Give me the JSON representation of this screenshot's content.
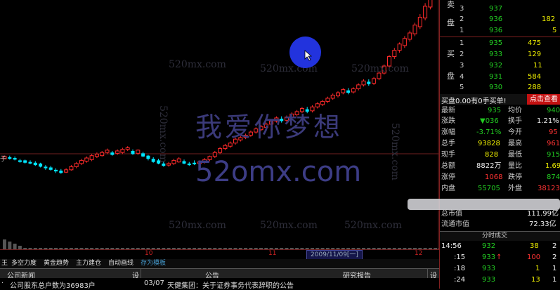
{
  "chart": {
    "watermark_url_small": "520mx.com",
    "watermark_cn": "我爱你梦想",
    "watermark_url_big": "52omx.com",
    "y_axis_cut_label": "子",
    "x_ticks": [
      "10",
      "11",
      "12"
    ],
    "date_label": "2009/11/09[一]",
    "colors": {
      "up": "#ff2b2b",
      "down": "#00e5ff",
      "background": "#000000",
      "axis": "#702020"
    },
    "candles": [
      {
        "o": 192,
        "c": 195,
        "h": 193,
        "l": 196
      },
      {
        "o": 194,
        "c": 192,
        "h": 191,
        "l": 196
      },
      {
        "o": 193,
        "c": 191,
        "h": 190,
        "l": 195
      },
      {
        "o": 190,
        "c": 188,
        "h": 187,
        "l": 192
      },
      {
        "o": 190,
        "c": 187,
        "h": 186,
        "l": 191
      },
      {
        "o": 188,
        "c": 186,
        "h": 185,
        "l": 190
      },
      {
        "o": 187,
        "c": 184,
        "h": 183,
        "l": 189
      },
      {
        "o": 186,
        "c": 182,
        "h": 181,
        "l": 187
      },
      {
        "o": 182,
        "c": 180,
        "h": 178,
        "l": 184
      },
      {
        "o": 181,
        "c": 178,
        "h": 177,
        "l": 183
      },
      {
        "o": 178,
        "c": 176,
        "h": 174,
        "l": 180
      },
      {
        "o": 177,
        "c": 174,
        "h": 173,
        "l": 179
      },
      {
        "o": 175,
        "c": 178,
        "h": 174,
        "l": 180
      },
      {
        "o": 178,
        "c": 182,
        "h": 177,
        "l": 184
      },
      {
        "o": 182,
        "c": 186,
        "h": 180,
        "l": 188
      },
      {
        "o": 186,
        "c": 190,
        "h": 184,
        "l": 192
      },
      {
        "o": 189,
        "c": 193,
        "h": 187,
        "l": 195
      },
      {
        "o": 191,
        "c": 196,
        "h": 189,
        "l": 198
      },
      {
        "o": 195,
        "c": 198,
        "h": 193,
        "l": 200
      },
      {
        "o": 196,
        "c": 200,
        "h": 195,
        "l": 202
      },
      {
        "o": 200,
        "c": 203,
        "h": 198,
        "l": 205
      },
      {
        "o": 200,
        "c": 197,
        "h": 196,
        "l": 202
      },
      {
        "o": 199,
        "c": 202,
        "h": 197,
        "l": 204
      },
      {
        "o": 200,
        "c": 204,
        "h": 198,
        "l": 206
      },
      {
        "o": 204,
        "c": 206,
        "h": 202,
        "l": 208
      },
      {
        "o": 202,
        "c": 198,
        "h": 197,
        "l": 204
      },
      {
        "o": 199,
        "c": 203,
        "h": 197,
        "l": 204
      },
      {
        "o": 199,
        "c": 195,
        "h": 194,
        "l": 201
      },
      {
        "o": 196,
        "c": 192,
        "h": 190,
        "l": 197
      },
      {
        "o": 192,
        "c": 188,
        "h": 187,
        "l": 194
      },
      {
        "o": 190,
        "c": 186,
        "h": 185,
        "l": 192
      },
      {
        "o": 186,
        "c": 183,
        "h": 182,
        "l": 188
      },
      {
        "o": 184,
        "c": 186,
        "h": 182,
        "l": 188
      },
      {
        "o": 186,
        "c": 190,
        "h": 184,
        "l": 192
      },
      {
        "o": 188,
        "c": 192,
        "h": 187,
        "l": 194
      },
      {
        "o": 189,
        "c": 186,
        "h": 185,
        "l": 191
      },
      {
        "o": 186,
        "c": 184,
        "h": 183,
        "l": 188
      },
      {
        "o": 187,
        "c": 185,
        "h": 184,
        "l": 190
      },
      {
        "o": 186,
        "c": 188,
        "h": 184,
        "l": 190
      },
      {
        "o": 188,
        "c": 191,
        "h": 186,
        "l": 193
      },
      {
        "o": 191,
        "c": 195,
        "h": 189,
        "l": 196
      },
      {
        "o": 195,
        "c": 200,
        "h": 193,
        "l": 202
      },
      {
        "o": 200,
        "c": 205,
        "h": 198,
        "l": 207
      },
      {
        "o": 205,
        "c": 209,
        "h": 203,
        "l": 211
      },
      {
        "o": 208,
        "c": 212,
        "h": 206,
        "l": 214
      },
      {
        "o": 212,
        "c": 217,
        "h": 210,
        "l": 219
      },
      {
        "o": 216,
        "c": 219,
        "h": 214,
        "l": 221
      },
      {
        "o": 219,
        "c": 222,
        "h": 217,
        "l": 224
      },
      {
        "o": 222,
        "c": 226,
        "h": 220,
        "l": 228
      },
      {
        "o": 226,
        "c": 230,
        "h": 224,
        "l": 232
      },
      {
        "o": 229,
        "c": 233,
        "h": 227,
        "l": 235
      },
      {
        "o": 232,
        "c": 236,
        "h": 230,
        "l": 238
      },
      {
        "o": 236,
        "c": 240,
        "h": 234,
        "l": 242
      },
      {
        "o": 240,
        "c": 244,
        "h": 238,
        "l": 246
      },
      {
        "o": 243,
        "c": 240,
        "h": 238,
        "l": 246
      },
      {
        "o": 241,
        "c": 245,
        "h": 239,
        "l": 247
      },
      {
        "o": 245,
        "c": 249,
        "h": 243,
        "l": 251
      },
      {
        "o": 248,
        "c": 252,
        "h": 246,
        "l": 254
      },
      {
        "o": 252,
        "c": 256,
        "h": 250,
        "l": 258
      },
      {
        "o": 255,
        "c": 252,
        "h": 250,
        "l": 258
      },
      {
        "o": 253,
        "c": 258,
        "h": 251,
        "l": 260
      },
      {
        "o": 258,
        "c": 262,
        "h": 256,
        "l": 264
      },
      {
        "o": 261,
        "c": 265,
        "h": 259,
        "l": 267
      },
      {
        "o": 265,
        "c": 269,
        "h": 263,
        "l": 271
      },
      {
        "o": 269,
        "c": 273,
        "h": 267,
        "l": 275
      },
      {
        "o": 272,
        "c": 276,
        "h": 270,
        "l": 278
      },
      {
        "o": 276,
        "c": 280,
        "h": 274,
        "l": 282
      },
      {
        "o": 279,
        "c": 276,
        "h": 274,
        "l": 282
      },
      {
        "o": 277,
        "c": 281,
        "h": 275,
        "l": 283
      },
      {
        "o": 281,
        "c": 286,
        "h": 279,
        "l": 288
      },
      {
        "o": 286,
        "c": 291,
        "h": 284,
        "l": 293
      },
      {
        "o": 290,
        "c": 287,
        "h": 285,
        "l": 293
      },
      {
        "o": 288,
        "c": 294,
        "h": 286,
        "l": 296
      },
      {
        "o": 294,
        "c": 301,
        "h": 292,
        "l": 303
      },
      {
        "o": 301,
        "c": 310,
        "h": 299,
        "l": 312
      },
      {
        "o": 310,
        "c": 322,
        "h": 307,
        "l": 324
      },
      {
        "o": 322,
        "c": 330,
        "h": 319,
        "l": 333
      },
      {
        "o": 330,
        "c": 338,
        "h": 327,
        "l": 340
      },
      {
        "o": 336,
        "c": 345,
        "h": 333,
        "l": 348
      },
      {
        "o": 344,
        "c": 352,
        "h": 341,
        "l": 355
      },
      {
        "o": 351,
        "c": 362,
        "h": 348,
        "l": 365
      },
      {
        "o": 360,
        "c": 372,
        "h": 357,
        "l": 376
      },
      {
        "o": 371,
        "c": 386,
        "h": 368,
        "l": 390
      },
      {
        "o": 385,
        "c": 400,
        "h": 382,
        "l": 405
      },
      {
        "o": 399,
        "c": 398,
        "h": 395,
        "l": 409
      },
      {
        "o": 398,
        "c": 403,
        "h": 394,
        "l": 410
      },
      {
        "o": 402,
        "c": 397,
        "h": 395,
        "l": 412
      },
      {
        "o": 398,
        "c": 404,
        "h": 396,
        "l": 411
      }
    ]
  },
  "xaxis": {
    "ticks": [
      "10",
      "11",
      "12"
    ]
  },
  "tabs": {
    "items": [
      "王",
      "多空力度",
      "黄金趋势",
      "主力建仓",
      "自动画线",
      "存为模板"
    ]
  },
  "panel": {
    "left_title": "公司新闻",
    "mid_title": "公告",
    "right_title": "研究报告",
    "set_label": "设",
    "left_text": "公司股东总户数为36983户",
    "mid_date": "03/07",
    "mid_text": "天健集团：关于证券事务代表辞职的公告"
  },
  "orderbook": {
    "sell_label": "卖",
    "buy_label": "买",
    "pan_label": "盘",
    "sell": [
      {
        "level": "3",
        "price": "937",
        "vol": ""
      },
      {
        "level": "2",
        "price": "936",
        "vol": "182"
      },
      {
        "level": "1",
        "price": "936",
        "vol": "5"
      }
    ],
    "buy": [
      {
        "level": "1",
        "price": "935",
        "vol": "475"
      },
      {
        "level": "2",
        "price": "933",
        "vol": "129"
      },
      {
        "level": "3",
        "price": "932",
        "vol": "11"
      },
      {
        "level": "4",
        "price": "931",
        "vol": "584"
      },
      {
        "level": "5",
        "price": "930",
        "vol": "288"
      }
    ],
    "buy_bar_text": "买盘0.00有0手买单!",
    "query_button": "点击查看"
  },
  "quote": {
    "rows": [
      {
        "l1": "最新",
        "v1": "935",
        "l2": "均价",
        "v2": "940"
      },
      {
        "l1": "涨跌",
        "v1": "▼036",
        "l2": "换手",
        "v2": "1.21%"
      },
      {
        "l1": "涨幅",
        "v1": "-3.71%",
        "l2": "今开",
        "v2": "95"
      },
      {
        "l1": "总手",
        "v1": "93828",
        "l2": "最高",
        "v2": "961"
      },
      {
        "l1": "现手",
        "v1": "828",
        "l2": "最低",
        "v2": "915"
      },
      {
        "l1": "总额",
        "v1": "8822万",
        "l2": "量比",
        "v2": "1.69"
      },
      {
        "l1": "涨停",
        "v1": "1068",
        "l2": "跌停",
        "v2": "874"
      },
      {
        "l1": "内盘",
        "v1": "55705",
        "l2": "外盘",
        "v2": "38123"
      }
    ],
    "total_cap_label": "总市值",
    "total_cap_value": "111.99亿",
    "float_cap_label": "流通市值",
    "float_cap_value": "72.33亿"
  },
  "trades": {
    "header": "分时成交",
    "rows": [
      {
        "time": "14:56",
        "price": "932",
        "arrow": "",
        "vol": "38",
        "n": "2"
      },
      {
        "time": ":15",
        "price": "933",
        "arrow": "↑",
        "vol": "100",
        "n": "2"
      },
      {
        "time": ":18",
        "price": "933",
        "arrow": "",
        "vol": "1",
        "n": "1"
      },
      {
        "time": ":24",
        "price": "933",
        "arrow": "",
        "vol": "13",
        "n": "1"
      }
    ]
  }
}
